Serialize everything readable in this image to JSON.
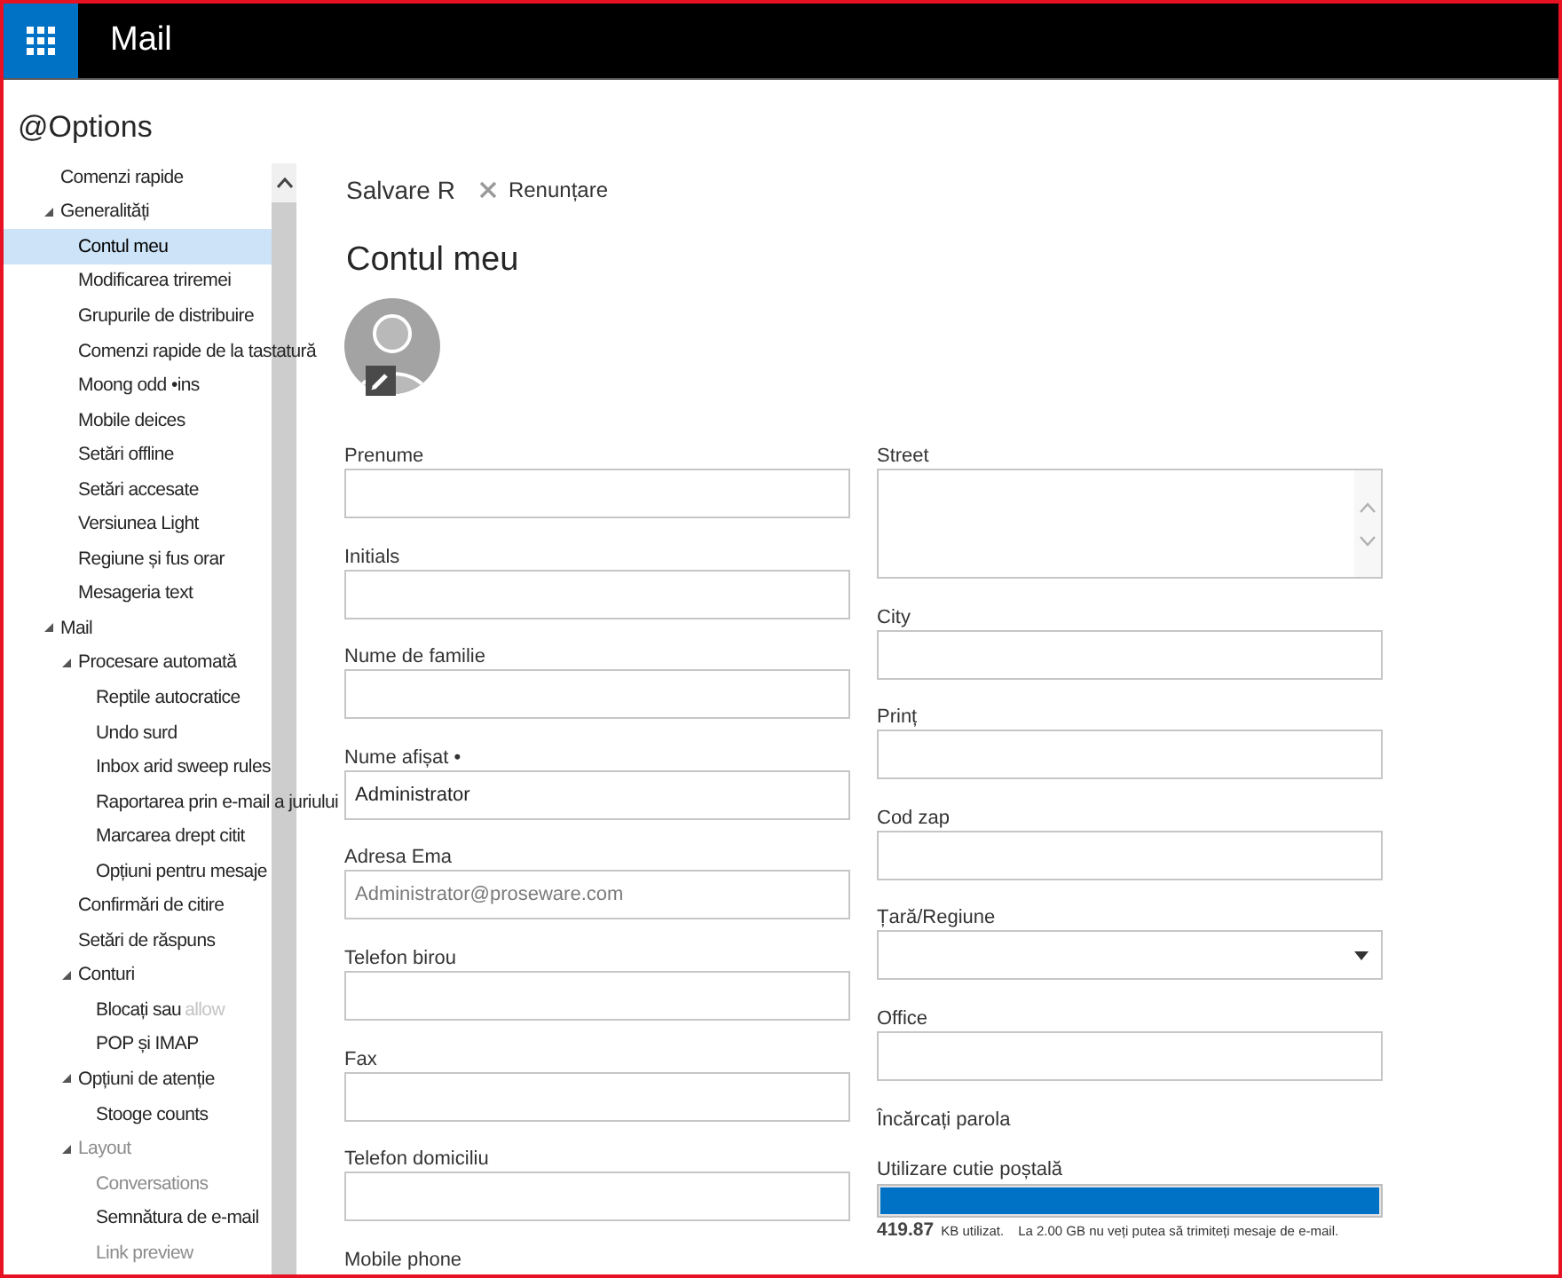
{
  "top_bar": {
    "title": "Mail"
  },
  "sidebar": {
    "title": "@Options",
    "items": [
      {
        "label": "Comenzi rapide",
        "selected": false,
        "disabled": false
      },
      {
        "label": "Generalități",
        "selected": false,
        "disabled": false,
        "expanded": true,
        "children": [
          {
            "label": "Contul meu",
            "selected": true,
            "disabled": false
          },
          {
            "label": "Modificarea triremei",
            "selected": false,
            "disabled": false
          },
          {
            "label": "Grupurile de distribuire",
            "selected": false,
            "disabled": false
          },
          {
            "label": "Comenzi rapide de la tastatură",
            "selected": false,
            "disabled": false
          },
          {
            "label": "Moong odd •ins",
            "selected": false,
            "disabled": false
          },
          {
            "label": "Mobile deices",
            "selected": false,
            "disabled": false
          },
          {
            "label": "Setări offline",
            "selected": false,
            "disabled": false
          },
          {
            "label": "Setări accesate",
            "selected": false,
            "disabled": false
          },
          {
            "label": "Versiunea Light",
            "selected": false,
            "disabled": false
          },
          {
            "label": "Regiune și fus orar",
            "selected": false,
            "disabled": false
          },
          {
            "label": "Mesageria text",
            "selected": false,
            "disabled": false
          }
        ]
      },
      {
        "label": "Mail",
        "selected": false,
        "disabled": false,
        "expanded": true,
        "children": [
          {
            "label": "Procesare automată",
            "selected": false,
            "disabled": false,
            "expanded": true,
            "children": [
              {
                "label": "Reptile autocratice",
                "selected": false,
                "disabled": false
              },
              {
                "label": "Undo surd",
                "selected": false,
                "disabled": false
              },
              {
                "label": "Inbox arid sweep rules",
                "selected": false,
                "disabled": false
              },
              {
                "label": "Raportarea prin e-mail a juriului",
                "selected": false,
                "disabled": false
              },
              {
                "label": "Marcarea drept citit",
                "selected": false,
                "disabled": false
              },
              {
                "label": "Opțiuni pentru mesaje",
                "selected": false,
                "disabled": false
              }
            ]
          },
          {
            "label": "Confirmări de citire",
            "selected": false,
            "disabled": false
          },
          {
            "label": "Setări de răspuns",
            "selected": false,
            "disabled": false
          },
          {
            "label": "Conturi",
            "selected": false,
            "disabled": false,
            "expanded": true,
            "children": [
              {
                "label": "Blocați sau",
                "faint_text": "allow",
                "selected": false,
                "disabled": false
              },
              {
                "label": "POP și IMAP",
                "selected": false,
                "disabled": false
              }
            ]
          },
          {
            "label": "Opțiuni de atenție",
            "selected": false,
            "disabled": false,
            "expanded": true,
            "children": [
              {
                "label": "Stooge counts",
                "selected": false,
                "disabled": false
              }
            ]
          },
          {
            "label": "Layout",
            "selected": false,
            "disabled": true,
            "expanded": true,
            "children": [
              {
                "label": "Conversations",
                "selected": false,
                "disabled": true
              },
              {
                "label": "Semnătura de e-mail",
                "selected": false,
                "disabled": false
              },
              {
                "label": "Link preview",
                "selected": false,
                "disabled": true
              }
            ]
          }
        ]
      }
    ]
  },
  "toolbar": {
    "save": "Salvare R",
    "cancel": "Renunțare"
  },
  "page_title": "Contul meu",
  "form": {
    "left_column": [
      {
        "kind": "text",
        "label": "Prenume"
      },
      {
        "kind": "text",
        "label": "Initials"
      },
      {
        "kind": "text",
        "label": "Nume de familie"
      },
      {
        "kind": "text",
        "label": "Nume afișat •",
        "value": "Administrator",
        "disabled": false
      },
      {
        "kind": "text",
        "label": "Adresa Ema",
        "value": "Administrator@proseware.com",
        "disabled": true
      },
      {
        "kind": "text",
        "label": "Telefon birou"
      },
      {
        "kind": "text",
        "label": "Fax"
      },
      {
        "kind": "text",
        "label": "Telefon domiciliu"
      },
      {
        "kind": "label",
        "label": "Mobile phone"
      }
    ],
    "right_column": [
      {
        "kind": "textarea",
        "label": "Street"
      },
      {
        "kind": "text",
        "label": "City"
      },
      {
        "kind": "text",
        "label": "Prinț"
      },
      {
        "kind": "text",
        "label": "Cod zap"
      },
      {
        "kind": "select",
        "label": "Țară/Regiune"
      },
      {
        "kind": "text",
        "label": "Office"
      },
      {
        "kind": "link",
        "label": "Încărcați parola"
      }
    ]
  },
  "mailbox_usage": {
    "label": "Utilizare cutie poștală",
    "level": 1,
    "amount": "419.87",
    "unit": "KB utilizat.",
    "note": "La 2.00 GB nu veți putea să trimiteți mesaje de e-mail."
  }
}
